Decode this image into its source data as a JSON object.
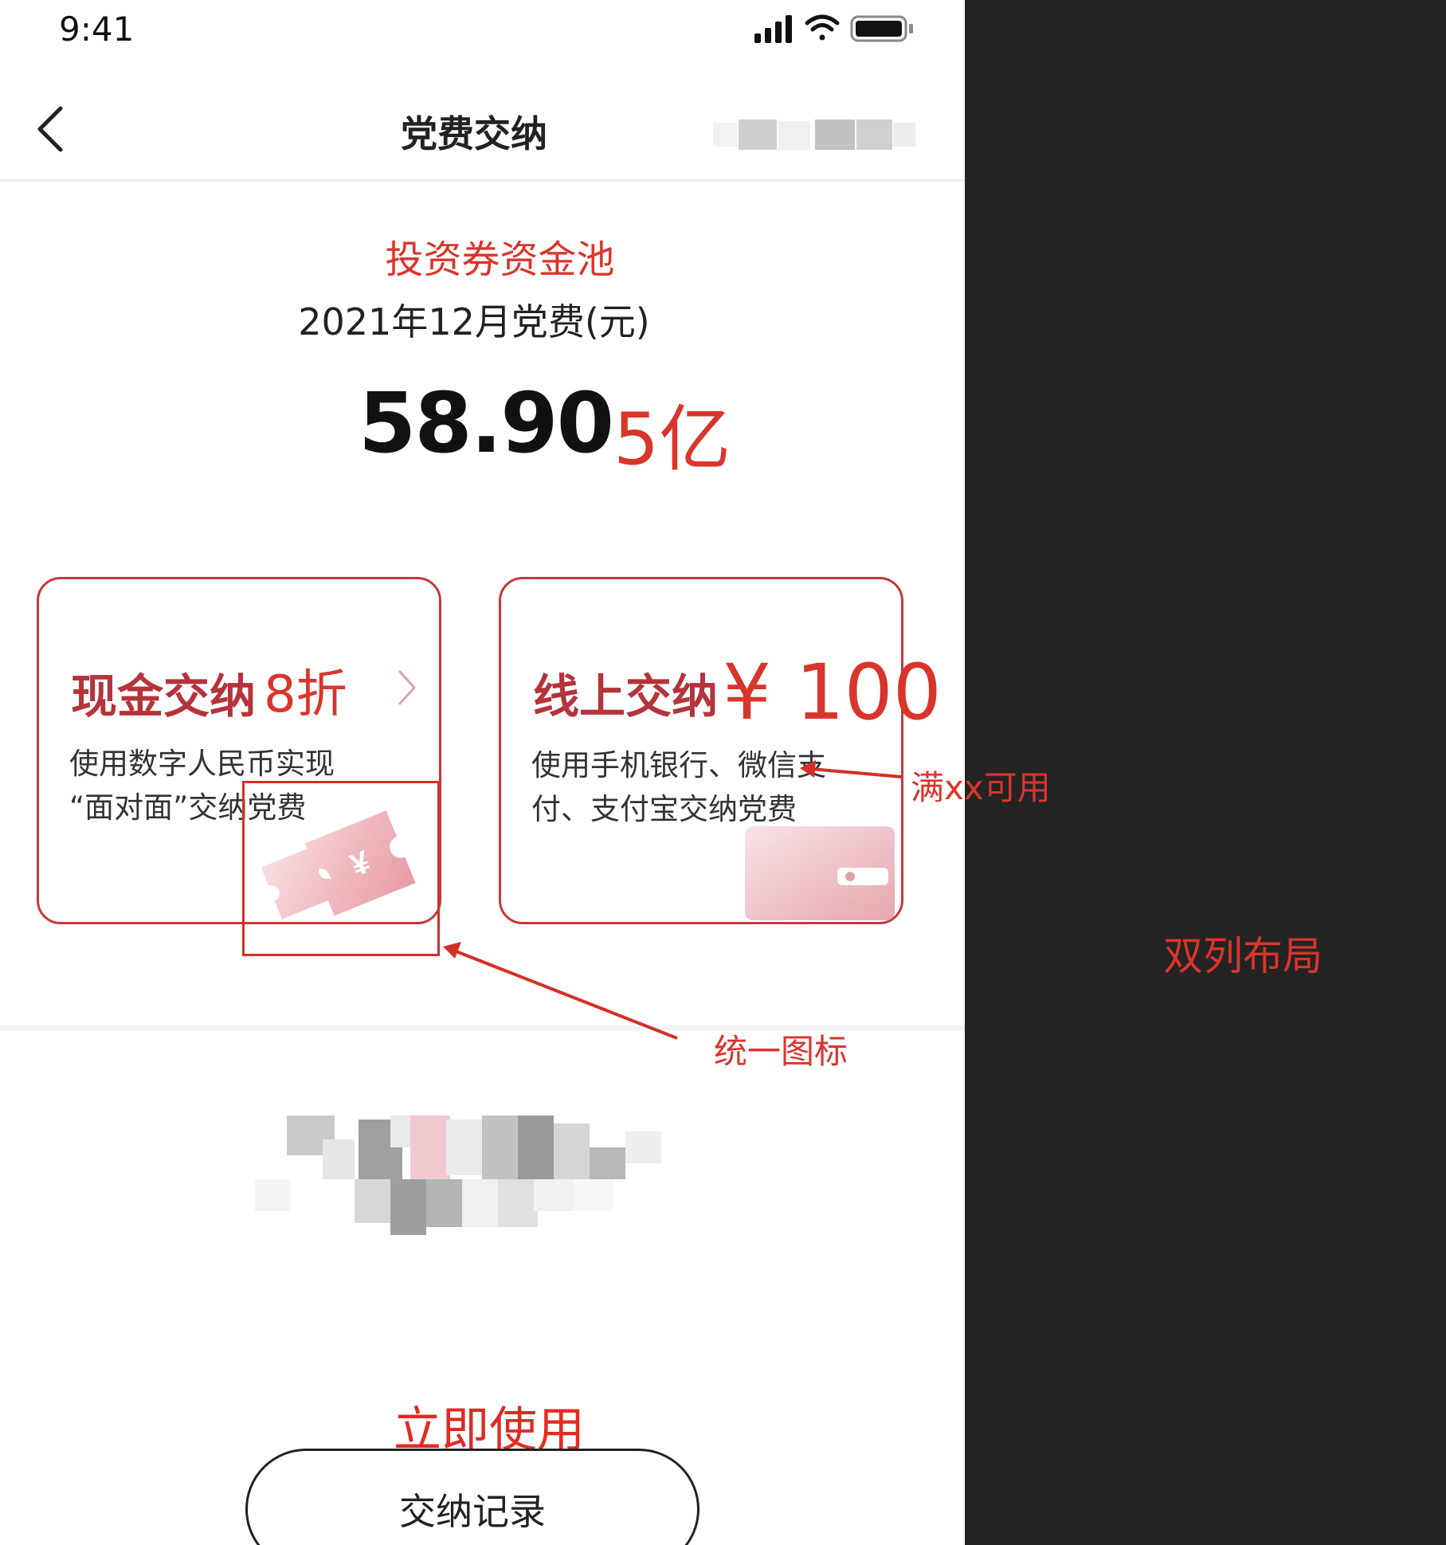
{
  "status_bar": {
    "time": "9:41"
  },
  "nav": {
    "title": "党费交纳"
  },
  "summary": {
    "pool_annotation": "投资券资金池",
    "period_label": "2021年12月党费(元)",
    "amount": "58.90",
    "amount_annotation": "5亿"
  },
  "cards": [
    {
      "title": "现金交纳",
      "badge": "8折",
      "desc_lines": [
        "使用数字人民币实现",
        "“面对面”交纳党费"
      ],
      "icon": "ticket-yuan-icon"
    },
    {
      "title": "线上交纳",
      "badge": "¥ 100",
      "desc_lines": [
        "使用手机银行、微信支",
        "付、支付宝交纳党费"
      ],
      "icon": "wallet-card-icon"
    }
  ],
  "annotations": {
    "threshold": "满xx可用",
    "unify_icon": "统一图标",
    "layout": "双列布局",
    "use_now": "立即使用"
  },
  "records_button": {
    "label": "交纳记录"
  },
  "colors": {
    "accent": "#d9352c",
    "card_border": "#c9383a",
    "card_title": "#b5333b",
    "side_panel": "#232323"
  }
}
